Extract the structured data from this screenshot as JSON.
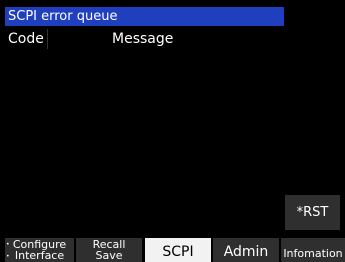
{
  "panel": {
    "title": "SCPI error queue",
    "columns": {
      "code": "Code",
      "message": "Message"
    },
    "rows": []
  },
  "side_buttons": {
    "rst": "*RST"
  },
  "softkeys": [
    {
      "line1": "Configure",
      "line2": "Interface",
      "selected": false
    },
    {
      "line1": "Recall",
      "line2": "Save",
      "selected": false
    },
    {
      "label": "SCPI",
      "selected": true
    },
    {
      "label": "Admin",
      "selected": false
    },
    {
      "label": "Infomation",
      "selected": false
    }
  ],
  "colors": {
    "title_bar": "#1f3fbf",
    "softkey_bg": "#2f2f2f",
    "softkey_selected": "#f2f2f2"
  }
}
